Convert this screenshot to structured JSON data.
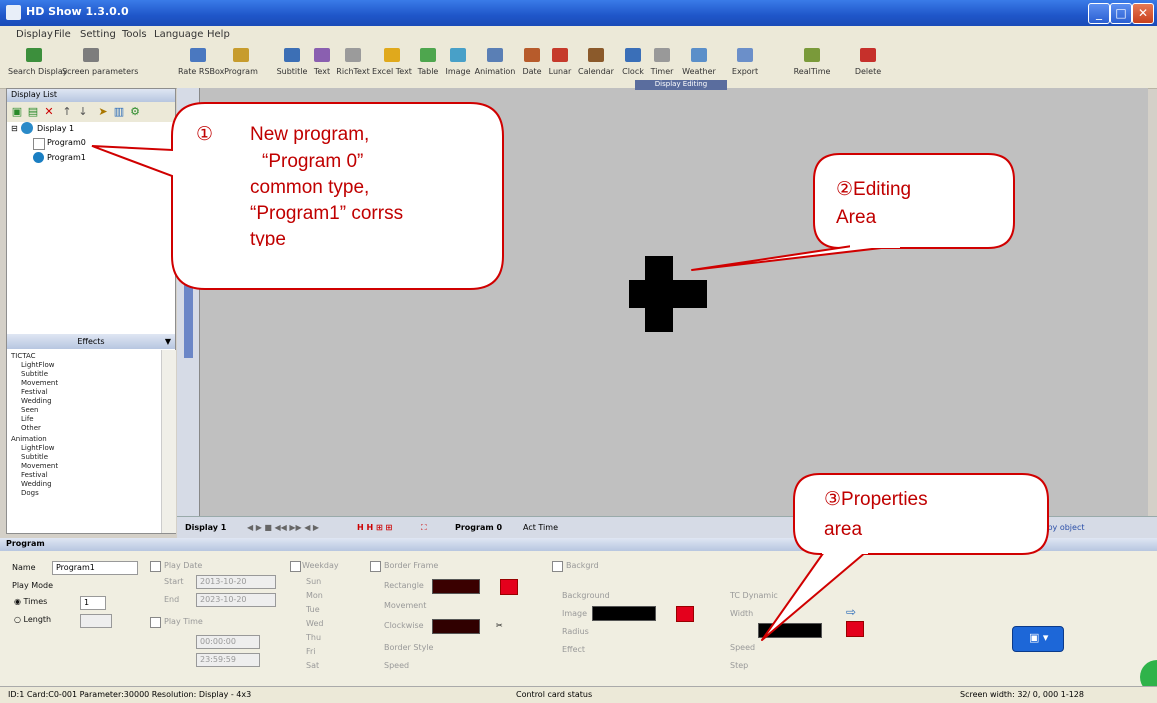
{
  "window": {
    "title": "HD Show 1.3.0.0",
    "min": "_",
    "max": "□",
    "close": "✕"
  },
  "menu": [
    "Display",
    "File",
    "Setting",
    "Tools",
    "Language",
    "Help"
  ],
  "toolbar": [
    {
      "label": "Search Display",
      "color": "#3c8f3c"
    },
    {
      "label": "Screen parameters",
      "color": "#7d7d7d"
    },
    {
      "label": "Rate RSBox",
      "color": "#4a78c0"
    },
    {
      "label": "Program",
      "color": "#c79c2d"
    },
    {
      "label": "Subtitle",
      "color": "#3c6fb5"
    },
    {
      "label": "Text",
      "color": "#8a5fb0"
    },
    {
      "label": "RichText",
      "color": "#9b9b9b"
    },
    {
      "label": "Excel Text",
      "color": "#e0a91c"
    },
    {
      "label": "Table",
      "color": "#4ea64e"
    },
    {
      "label": "Image",
      "color": "#48a0c8"
    },
    {
      "label": "Animation",
      "color": "#5a7fb5"
    },
    {
      "label": "Date",
      "color": "#b75b2b"
    },
    {
      "label": "Lunar",
      "color": "#c63a2b"
    },
    {
      "label": "Calendar",
      "color": "#8b5a2b"
    },
    {
      "label": "Clock",
      "color": "#3a6fb8"
    },
    {
      "label": "Timer",
      "color": "#999999"
    },
    {
      "label": "Weather",
      "color": "#5b8fc9"
    },
    {
      "label": "Export",
      "color": "#6b8fc9"
    },
    {
      "label": "RealTime",
      "color": "#7a9a3a"
    },
    {
      "label": "Delete",
      "color": "#c6302b"
    }
  ],
  "left_panel": {
    "header": "Display List",
    "tree": {
      "display": "Display 1",
      "program0": "Program0",
      "program1": "Program1"
    },
    "effects_header": "Effects",
    "effects_groups": [
      {
        "name": "TICTAC",
        "items": [
          "LightFlow",
          "Subtitle",
          "Movement",
          "Festival",
          "Wedding",
          "Seen",
          "Life",
          "Other"
        ]
      },
      {
        "name": "Animation",
        "items": [
          "LightFlow",
          "Subtitle",
          "Movement",
          "Festival",
          "Wedding",
          "Dogs"
        ]
      }
    ]
  },
  "canvas": {
    "tab_label": "Display Editing"
  },
  "display_bar": {
    "display_label": "Display 1",
    "program_label": "Program 0",
    "extra": "Act Time",
    "right_note": "Copy object"
  },
  "properties": {
    "header": "Program",
    "name_label": "Name",
    "name_value": "Program1",
    "play_mode": "Play Mode",
    "times_label": "Times",
    "times_value": "1",
    "length_label": "Length",
    "play_date": "Play Date",
    "start_label": "Start",
    "end_label": "End",
    "start_date": "2013-10-20",
    "end_date": "2023-10-20",
    "play_time": "Play Time",
    "start_time": "00:00:00",
    "end_time": "23:59:59",
    "weekday": "Weekday",
    "days": [
      "Sun",
      "Mon",
      "Tue",
      "Wed",
      "Thu",
      "Fri",
      "Sat"
    ],
    "border_label": "Border Frame",
    "border_rows": [
      "Rectangle",
      "Movement",
      "Clockwise"
    ],
    "border_style": "Border Style",
    "speed": "Speed",
    "bg_label": "Backgrd",
    "bg_rows": [
      "Background",
      "Radius",
      "Effect"
    ],
    "image_label": "Image",
    "right_col": [
      "TC Dynamic",
      "Width",
      "Speed",
      "Step"
    ],
    "colors": {
      "red": "#e4001c",
      "black": "#000000",
      "blue": "#1d67d8"
    }
  },
  "status": {
    "left": "ID:1 Card:C0-001 Parameter:30000 Resolution: Display - 4x3",
    "center": "Control card status",
    "right": "Screen width: 32/ 0, 000 1-128"
  },
  "annotations": {
    "c1_num": "①",
    "c1_lines": [
      "New program,",
      "“Program 0”",
      "common type,",
      "“Program1” corrss",
      "type"
    ],
    "c2_lines": [
      "②Editing",
      "Area"
    ],
    "c3_lines": [
      "③Properties",
      "area"
    ]
  }
}
